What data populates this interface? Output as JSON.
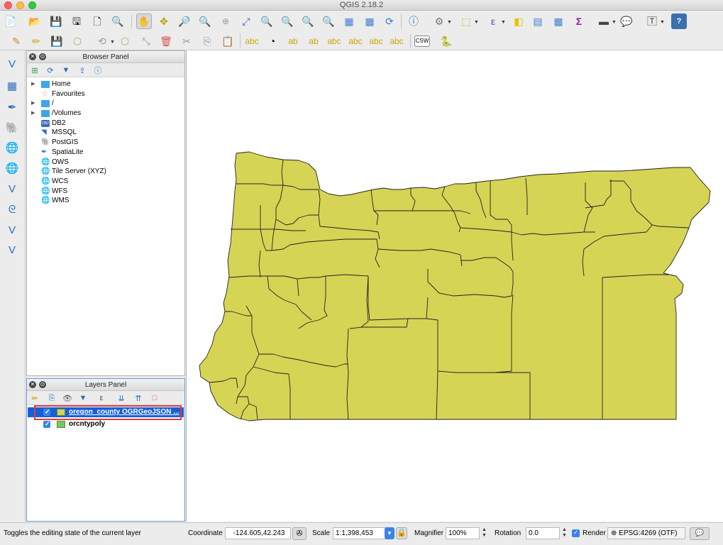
{
  "window": {
    "title": "QGIS 2.18.2"
  },
  "toolbar_icons": [
    "new-project-icon",
    "open-project-icon",
    "save-project-icon",
    "save-as-icon",
    "new-print-composer-icon",
    "composer-manager-icon",
    "pan-icon",
    "pan-to-selection-icon",
    "zoom-in-icon",
    "zoom-out-icon",
    "zoom-native-icon",
    "zoom-full-icon",
    "zoom-to-selection-icon",
    "zoom-to-layer-icon",
    "zoom-last-icon",
    "zoom-next-icon",
    "refresh-icon",
    "identify-icon",
    "measure-icon",
    "select-feature-icon",
    "deselect-icon",
    "attribute-table-icon",
    "field-calculator-icon",
    "statistics-icon",
    "measure-line-icon",
    "map-tips-icon",
    "text-annotation-icon",
    "help-icon"
  ],
  "browser_panel": {
    "title": "Browser Panel",
    "items": [
      {
        "label": "Home",
        "icon": "folder-icon",
        "expandable": true
      },
      {
        "label": "Favourites",
        "icon": "star-icon",
        "expandable": false
      },
      {
        "label": "/",
        "icon": "folder-icon",
        "expandable": true
      },
      {
        "label": "/Volumes",
        "icon": "folder-icon",
        "expandable": true
      },
      {
        "label": "DB2",
        "icon": "db2-icon",
        "expandable": false
      },
      {
        "label": "MSSQL",
        "icon": "mssql-icon",
        "expandable": false
      },
      {
        "label": "PostGIS",
        "icon": "postgis-icon",
        "expandable": false
      },
      {
        "label": "SpatiaLite",
        "icon": "spatialite-icon",
        "expandable": false
      },
      {
        "label": "OWS",
        "icon": "ows-icon",
        "expandable": false
      },
      {
        "label": "Tile Server (XYZ)",
        "icon": "xyz-icon",
        "expandable": false
      },
      {
        "label": "WCS",
        "icon": "wcs-icon",
        "expandable": false
      },
      {
        "label": "WFS",
        "icon": "wfs-icon",
        "expandable": false
      },
      {
        "label": "WMS",
        "icon": "wms-icon",
        "expandable": false
      }
    ]
  },
  "layers_panel": {
    "title": "Layers Panel",
    "layers": [
      {
        "name": "oregon_county OGRGeoJSON ...",
        "checked": true,
        "selected": true,
        "swatch": "#d4d354"
      },
      {
        "name": "orcntypoly",
        "checked": true,
        "selected": false,
        "swatch": "#7ec36a"
      }
    ]
  },
  "map": {
    "fill": "#d6d455",
    "stroke": "#222222"
  },
  "statusbar": {
    "message": "Toggles the editing state of the current layer",
    "coordinate_label": "Coordinate",
    "coordinate_value": "-124.605,42.243",
    "scale_label": "Scale",
    "scale_value": "1:1,398,453",
    "magnifier_label": "Magnifier",
    "magnifier_value": "100%",
    "rotation_label": "Rotation",
    "rotation_value": "0.0",
    "render_label": "Render",
    "render_checked": true,
    "crs_value": "EPSG:4269 (OTF)"
  },
  "highlight_color": "#e53a3a"
}
